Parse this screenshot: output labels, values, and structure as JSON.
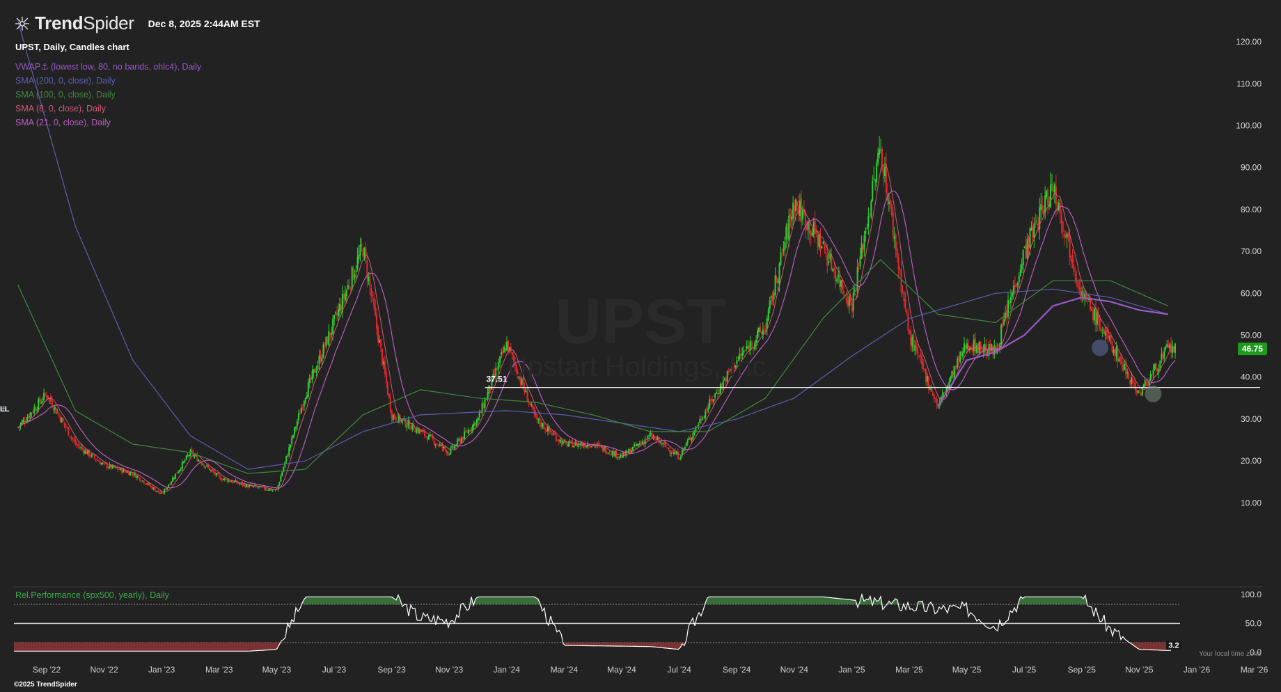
{
  "app": {
    "brand_prefix": "Trend",
    "brand_suffix": "Spider",
    "timestamp": "Dec 8, 2025 2:44AM EST",
    "copyright": "©2025 TrendSpider",
    "timezone_note": "Your local time zone"
  },
  "header": {
    "chart_title": "UPST, Daily, Candles chart",
    "legend": [
      {
        "label": "VWAP⚓ (lowest low, 80, no bands, ohlc4), Daily",
        "color": "#9b59c9"
      },
      {
        "label": "SMA (200, 0, close), Daily",
        "color": "#5b5fb0"
      },
      {
        "label": "SMA (100, 0, close), Daily",
        "color": "#3f8a3f"
      },
      {
        "label": "SMA (8, 0, close), Daily",
        "color": "#d05a78"
      },
      {
        "label": "SMA (21, 0, close), Daily",
        "color": "#b65fbf"
      }
    ]
  },
  "watermark": {
    "ticker": "UPST",
    "company": "Upstart Holdings, Inc."
  },
  "indicator": {
    "label": "Rel.Performance (spx500, yearly), Daily",
    "last_value": "3.2"
  },
  "colors": {
    "background": "#222222",
    "candle_up": "#2fd12f",
    "candle_down": "#e02a2a",
    "price_badge": "#1e9a1e",
    "rp_fill_green": "#3d7a3d",
    "rp_fill_red": "#8a3535"
  },
  "chart_data": {
    "type": "candlestick",
    "ticker": "UPST",
    "timeframe": "Daily",
    "last_price": 46.75,
    "support_level": 37.51,
    "anchor_label": "LL",
    "anchor_date": "Apr 2025",
    "anchor_price": 31.5,
    "y_axis": {
      "ticks": [
        "10.00",
        "20.00",
        "30.00",
        "40.00",
        "50.00",
        "60.00",
        "70.00",
        "80.00",
        "90.00",
        "100.00",
        "110.00",
        "120.00"
      ],
      "range": [
        0,
        125
      ]
    },
    "x_axis": {
      "ticks": [
        "Sep '22",
        "Nov '22",
        "Jan '23",
        "Mar '23",
        "May '23",
        "Jul '23",
        "Sep '23",
        "Nov '23",
        "Jan '24",
        "Mar '24",
        "May '24",
        "Jul '24",
        "Sep '24",
        "Nov '24",
        "Jan '25",
        "Mar '25",
        "May '25",
        "Jul '25",
        "Sep '25",
        "Nov '25",
        "Jan '26",
        "Mar '26"
      ]
    },
    "price_path": [
      [
        "Aug '22",
        28
      ],
      [
        "Sep '22",
        36
      ],
      [
        "Oct '22",
        24
      ],
      [
        "Nov '22",
        19
      ],
      [
        "Dec '22",
        17
      ],
      [
        "Jan '23",
        12
      ],
      [
        "Feb '23",
        22
      ],
      [
        "Mar '23",
        16
      ],
      [
        "Apr '23",
        14
      ],
      [
        "May '23",
        13
      ],
      [
        "Jun '23",
        36
      ],
      [
        "Jul '23",
        53
      ],
      [
        "Aug '23",
        71
      ],
      [
        "Sep '23",
        31
      ],
      [
        "Oct '23",
        27
      ],
      [
        "Nov '23",
        22
      ],
      [
        "Dec '23",
        30
      ],
      [
        "Jan '24",
        48
      ],
      [
        "Feb '24",
        30
      ],
      [
        "Mar '24",
        24
      ],
      [
        "Apr '24",
        24
      ],
      [
        "May '24",
        21
      ],
      [
        "Jun '24",
        26
      ],
      [
        "Jul '24",
        21
      ],
      [
        "Aug '24",
        33
      ],
      [
        "Sep '24",
        44
      ],
      [
        "Oct '24",
        52
      ],
      [
        "Nov '24",
        82
      ],
      [
        "Dec '24",
        71
      ],
      [
        "Jan '25",
        57
      ],
      [
        "Feb '25",
        95
      ],
      [
        "Mar '25",
        50
      ],
      [
        "Apr '25",
        33
      ],
      [
        "May '25",
        48
      ],
      [
        "Jun '25",
        46
      ],
      [
        "Jul '25",
        70
      ],
      [
        "Aug '25",
        86
      ],
      [
        "Sep '25",
        60
      ],
      [
        "Oct '25",
        48
      ],
      [
        "Nov '25",
        36
      ],
      [
        "Dec '25",
        46.75
      ]
    ],
    "series": [
      {
        "name": "SMA (200, 0, close)",
        "values": [
          [
            "Aug '22",
            125
          ],
          [
            "Oct '22",
            76
          ],
          [
            "Dec '22",
            44
          ],
          [
            "Feb '23",
            26
          ],
          [
            "Apr '23",
            18
          ],
          [
            "Jun '23",
            20
          ],
          [
            "Aug '23",
            27
          ],
          [
            "Oct '23",
            31
          ],
          [
            "Jan '24",
            32
          ],
          [
            "Mar '24",
            31
          ],
          [
            "May '24",
            29
          ],
          [
            "Jul '24",
            27
          ],
          [
            "Sep '24",
            30
          ],
          [
            "Nov '24",
            35
          ],
          [
            "Jan '25",
            45
          ],
          [
            "Mar '25",
            54
          ],
          [
            "Jun '25",
            60
          ],
          [
            "Aug '25",
            61
          ],
          [
            "Oct '25",
            59
          ],
          [
            "Dec '25",
            55
          ]
        ]
      },
      {
        "name": "SMA (100, 0, close)",
        "values": [
          [
            "Aug '22",
            62
          ],
          [
            "Oct '22",
            32
          ],
          [
            "Dec '22",
            24
          ],
          [
            "Feb '23",
            22
          ],
          [
            "Apr '23",
            17
          ],
          [
            "Jun '23",
            18
          ],
          [
            "Aug '23",
            31
          ],
          [
            "Oct '23",
            37
          ],
          [
            "Dec '23",
            35
          ],
          [
            "Feb '24",
            34
          ],
          [
            "Apr '24",
            31
          ],
          [
            "Jun '24",
            27
          ],
          [
            "Aug '24",
            27
          ],
          [
            "Oct '24",
            35
          ],
          [
            "Dec '24",
            54
          ],
          [
            "Feb '25",
            68
          ],
          [
            "Apr '25",
            55
          ],
          [
            "Jun '25",
            53
          ],
          [
            "Aug '25",
            63
          ],
          [
            "Oct '25",
            63
          ],
          [
            "Dec '25",
            57
          ]
        ]
      },
      {
        "name": "VWAP (lowest low, 80, no bands, ohlc4)",
        "values": [
          [
            "Apr '25",
            33
          ],
          [
            "May '25",
            44
          ],
          [
            "Jun '25",
            46
          ],
          [
            "Jul '25",
            50
          ],
          [
            "Aug '25",
            57
          ],
          [
            "Sep '25",
            59
          ],
          [
            "Oct '25",
            58
          ],
          [
            "Nov '25",
            56
          ],
          [
            "Dec '25",
            55
          ]
        ]
      },
      {
        "name": "Rel.Performance (spx500, yearly)",
        "ylim": [
          0,
          100
        ],
        "ticks": [
          "0.0",
          "50.0",
          "100.0"
        ],
        "values": [
          [
            "Aug '22",
            2
          ],
          [
            "Apr '23",
            2
          ],
          [
            "May '23",
            5
          ],
          [
            "Jun '23",
            96
          ],
          [
            "Sep '23",
            96
          ],
          [
            "Oct '23",
            60
          ],
          [
            "Nov '23",
            55
          ],
          [
            "Dec '23",
            96
          ],
          [
            "Feb '24",
            96
          ],
          [
            "Mar '24",
            12
          ],
          [
            "Jun '24",
            10
          ],
          [
            "Jul '24",
            5
          ],
          [
            "Aug '24",
            96
          ],
          [
            "Dec '24",
            96
          ],
          [
            "Apr '25",
            75
          ],
          [
            "May '25",
            75
          ],
          [
            "Jun '25",
            45
          ],
          [
            "Jul '25",
            96
          ],
          [
            "Sep '25",
            96
          ],
          [
            "Oct '25",
            40
          ],
          [
            "Nov '25",
            5
          ],
          [
            "Dec '25",
            3.2
          ]
        ]
      }
    ]
  }
}
